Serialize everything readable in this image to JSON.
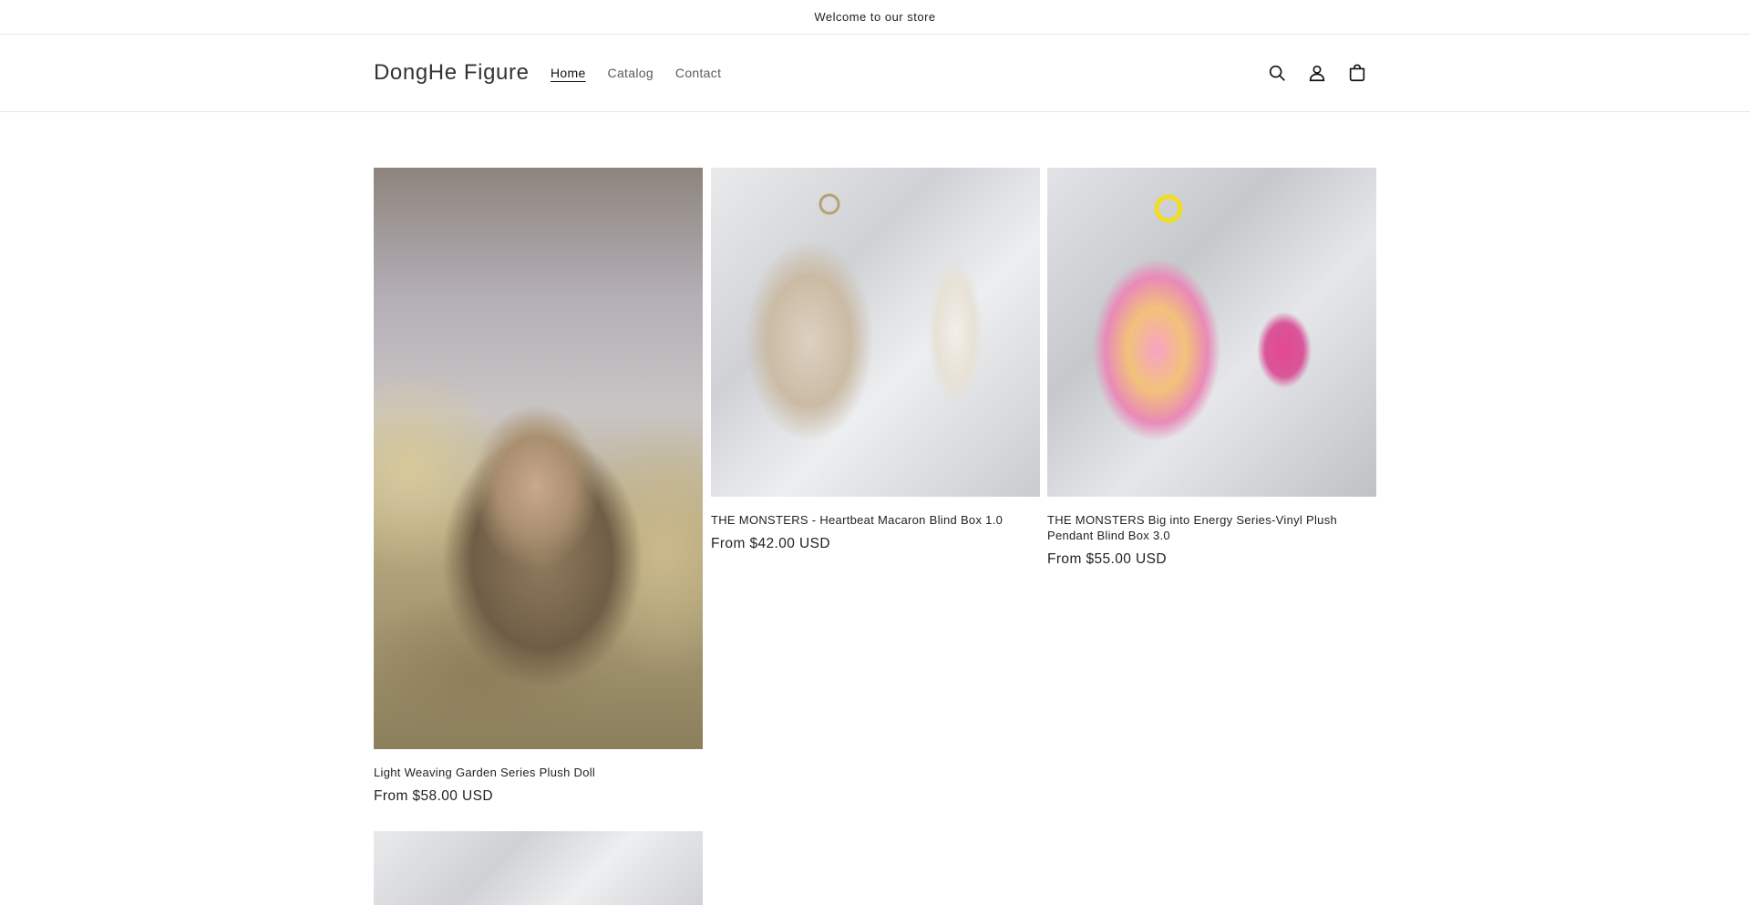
{
  "announcement": {
    "text": "Welcome to our store"
  },
  "header": {
    "logo": "DongHe Figure",
    "nav": [
      {
        "label": "Home",
        "active": true
      },
      {
        "label": "Catalog",
        "active": false
      },
      {
        "label": "Contact",
        "active": false
      }
    ],
    "icons": [
      "search-icon",
      "account-icon",
      "cart-icon"
    ]
  },
  "products": [
    {
      "title": "Light Weaving Garden Series Plush Doll",
      "price": "From $58.00 USD",
      "image": "plush-doll-garden-photo"
    },
    {
      "title": "THE MONSTERS - Heartbeat Macaron Blind Box 1.0",
      "price": "From $42.00 USD",
      "image": "beige-monster-plush-photo"
    },
    {
      "title": "THE MONSTERS Big into Energy Series-Vinyl Plush Pendant Blind Box 3.0",
      "price": "From $55.00 USD",
      "image": "pink-monster-plush-photo"
    },
    {
      "title": "",
      "price": "",
      "image": "monster-plush-photo"
    }
  ],
  "colors": {
    "text": "#121212",
    "border": "#e6e6e6",
    "background": "#ffffff"
  }
}
